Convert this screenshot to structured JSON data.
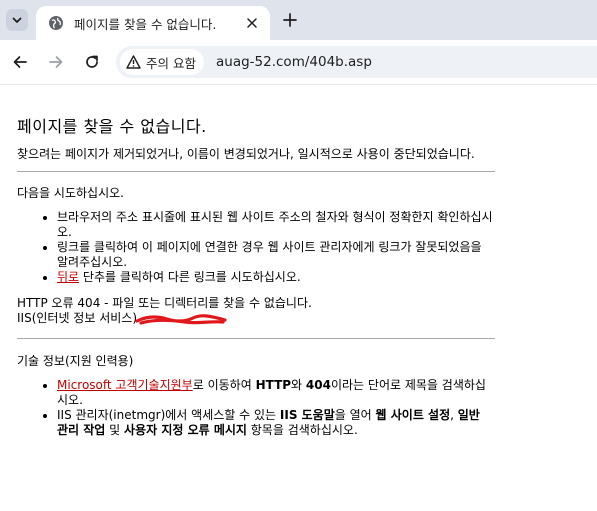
{
  "browser": {
    "tab_title": "페이지를 찾을 수 없습니다.",
    "security_chip": "주의 요함",
    "url": "auag-52.com/404b.asp"
  },
  "page": {
    "heading": "페이지를 찾을 수 없습니다.",
    "intro": "찾으려는 페이지가 제거되었거나, 이름이 변경되었거나, 일시적으로 사용이 중단되었습니다.",
    "try_title": "다음을 시도하십시오.",
    "try_items": [
      {
        "text": "브라우저의 주소 표시줄에 표시된 웹 사이트 주소의 철자와 형식이 정확한지 확인하십시오."
      },
      {
        "text": "링크를 클릭하여 이 페이지에 연결한 경우 웹 사이트 관리자에게 링크가 잘못되었음을 알려주십시오."
      },
      {
        "link": "뒤로",
        "text": " 단추를 클릭하여 다른 링크를 시도하십시오."
      }
    ],
    "error_line1": "HTTP 오류 404 - 파일 또는 디렉터리를 찾을 수 없습니다.",
    "error_line2": "IIS(인터넷 정보 서비스) ",
    "tech_title": "기술 정보(지원 인력용)",
    "tech_items": [
      {
        "link": "Microsoft 고객기술지원부",
        "t1": "로 이동하여 ",
        "b1": "HTTP",
        "t2": "와 ",
        "b2": "404",
        "t3": "이라는 단어로 제목을 검색하십시오."
      },
      {
        "t1": "IIS 관리자(inetmgr)에서 액세스할 수 있는 ",
        "b1": "IIS 도움말",
        "t2": "을 열어 ",
        "b2": "웹 사이트 설정",
        "t3": ", ",
        "b3": "일반 관리 작업",
        "t4": " 및 ",
        "b4": "사용자 지정 오류 메시지",
        "t5": " 항목을 검색하십시오."
      }
    ]
  },
  "colors": {
    "link": "#c00000",
    "redaction": "#e0181c",
    "tabstrip": "#dfe3eb"
  }
}
